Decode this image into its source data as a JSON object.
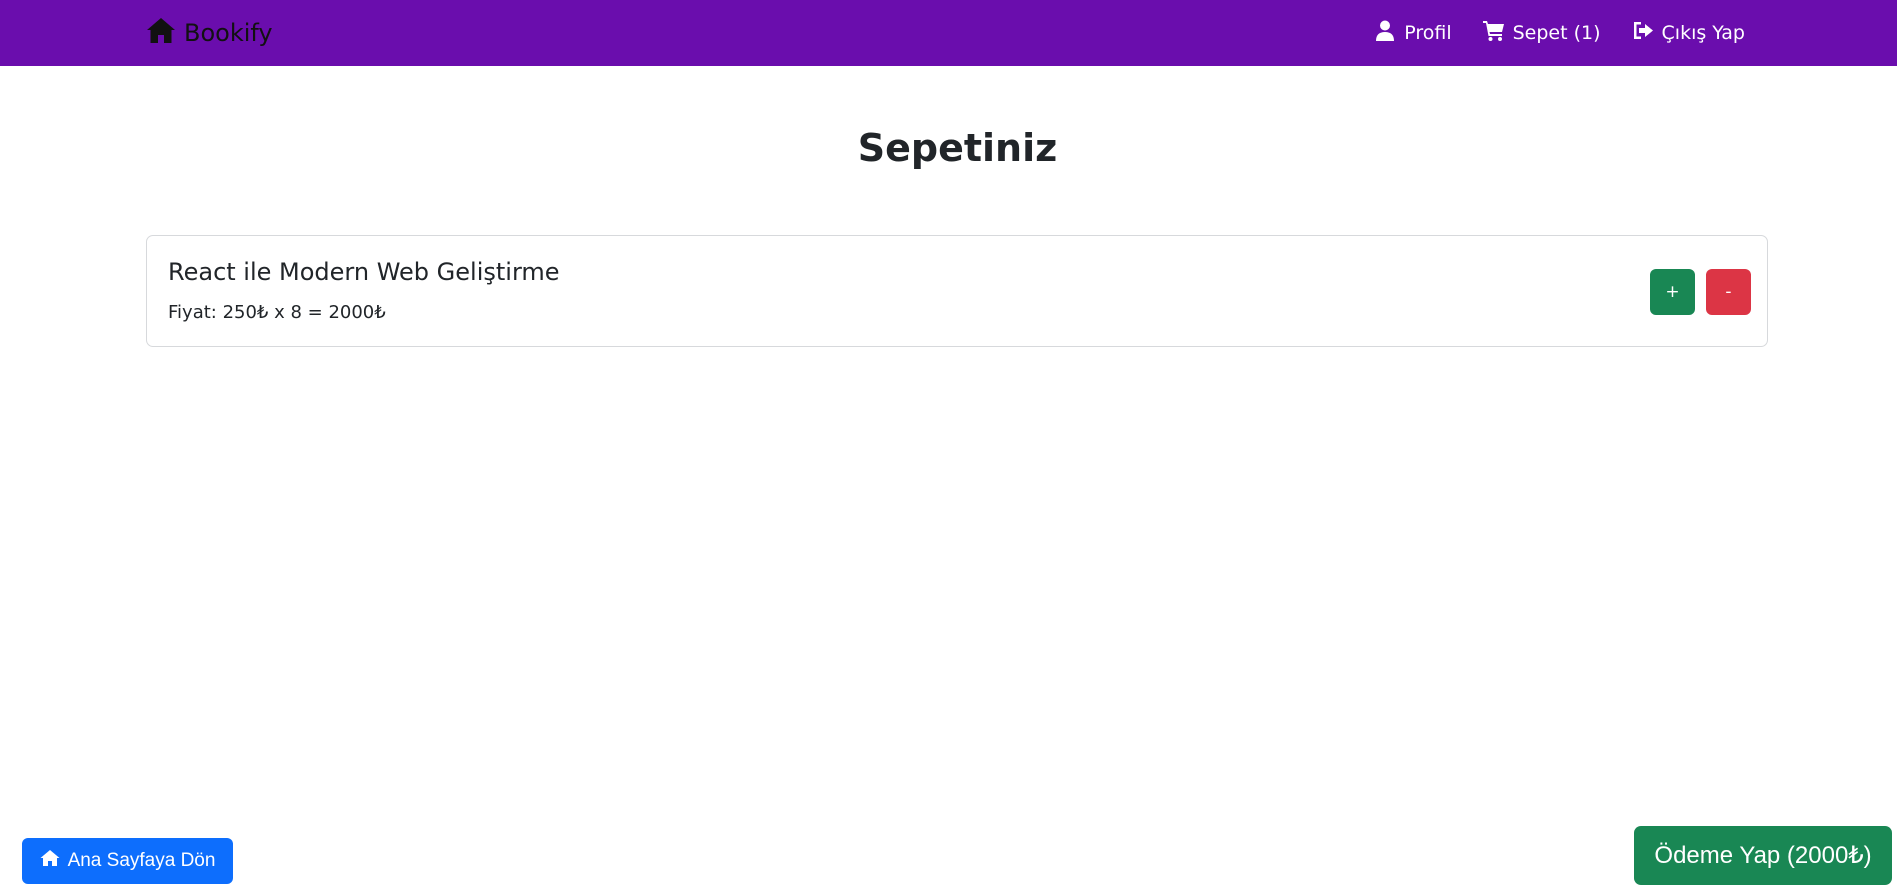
{
  "navbar": {
    "brand_label": "Bookify",
    "brand_icon": "home-icon",
    "bg_color": "#6a0dad",
    "links": [
      {
        "label": "Profil",
        "icon": "user-icon"
      },
      {
        "label": "Sepet (1)",
        "icon": "cart-icon"
      },
      {
        "label": "Çıkış Yap",
        "icon": "logout-icon"
      }
    ]
  },
  "page": {
    "title": "Sepetiniz"
  },
  "cart": {
    "items": [
      {
        "title": "React ile Modern Web Geliştirme",
        "price_text": "Fiyat: 250₺ x 8 = 2000₺",
        "increase_label": "+",
        "decrease_label": "-"
      }
    ]
  },
  "footer": {
    "home_button_label": "Ana Sayfaya Dön",
    "home_button_icon": "home-icon",
    "pay_button_label": "Ödeme Yap (2000₺)"
  },
  "colors": {
    "primary": "#0d6efd",
    "success": "#198754",
    "danger": "#dc3545"
  }
}
